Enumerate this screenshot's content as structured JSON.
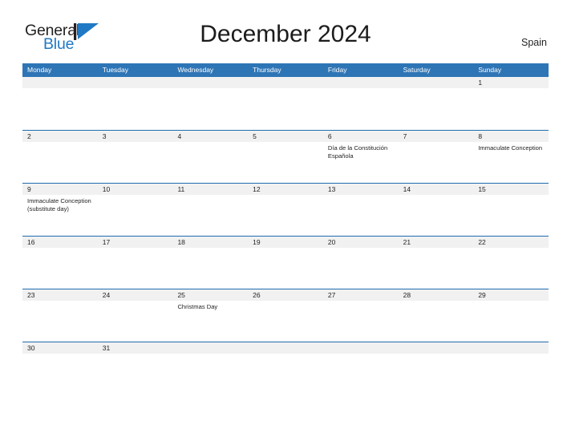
{
  "brand": {
    "name_part1": "General",
    "name_part2": "Blue",
    "primary_color": "#2079c4",
    "text_color": "#231f20"
  },
  "header": {
    "title": "December 2024",
    "country": "Spain"
  },
  "theme": {
    "header_blue": "#2e75b6",
    "divider_blue": "#1f6cb0",
    "date_strip_gray": "#f1f1f1"
  },
  "calendar": {
    "weekdays": [
      "Monday",
      "Tuesday",
      "Wednesday",
      "Thursday",
      "Friday",
      "Saturday",
      "Sunday"
    ],
    "weeks": [
      {
        "days": [
          {
            "date": "",
            "events": []
          },
          {
            "date": "",
            "events": []
          },
          {
            "date": "",
            "events": []
          },
          {
            "date": "",
            "events": []
          },
          {
            "date": "",
            "events": []
          },
          {
            "date": "",
            "events": []
          },
          {
            "date": "1",
            "events": []
          }
        ]
      },
      {
        "days": [
          {
            "date": "2",
            "events": []
          },
          {
            "date": "3",
            "events": []
          },
          {
            "date": "4",
            "events": []
          },
          {
            "date": "5",
            "events": []
          },
          {
            "date": "6",
            "events": [
              "Día de la Constitución Española"
            ]
          },
          {
            "date": "7",
            "events": []
          },
          {
            "date": "8",
            "events": [
              "Immaculate Conception"
            ]
          }
        ]
      },
      {
        "days": [
          {
            "date": "9",
            "events": [
              "Immaculate Conception (substitute day)"
            ]
          },
          {
            "date": "10",
            "events": []
          },
          {
            "date": "11",
            "events": []
          },
          {
            "date": "12",
            "events": []
          },
          {
            "date": "13",
            "events": []
          },
          {
            "date": "14",
            "events": []
          },
          {
            "date": "15",
            "events": []
          }
        ]
      },
      {
        "days": [
          {
            "date": "16",
            "events": []
          },
          {
            "date": "17",
            "events": []
          },
          {
            "date": "18",
            "events": []
          },
          {
            "date": "19",
            "events": []
          },
          {
            "date": "20",
            "events": []
          },
          {
            "date": "21",
            "events": []
          },
          {
            "date": "22",
            "events": []
          }
        ]
      },
      {
        "days": [
          {
            "date": "23",
            "events": []
          },
          {
            "date": "24",
            "events": []
          },
          {
            "date": "25",
            "events": [
              "Christmas Day"
            ]
          },
          {
            "date": "26",
            "events": []
          },
          {
            "date": "27",
            "events": []
          },
          {
            "date": "28",
            "events": []
          },
          {
            "date": "29",
            "events": []
          }
        ]
      },
      {
        "days": [
          {
            "date": "30",
            "events": []
          },
          {
            "date": "31",
            "events": []
          },
          {
            "date": "",
            "events": []
          },
          {
            "date": "",
            "events": []
          },
          {
            "date": "",
            "events": []
          },
          {
            "date": "",
            "events": []
          },
          {
            "date": "",
            "events": []
          }
        ]
      }
    ]
  }
}
